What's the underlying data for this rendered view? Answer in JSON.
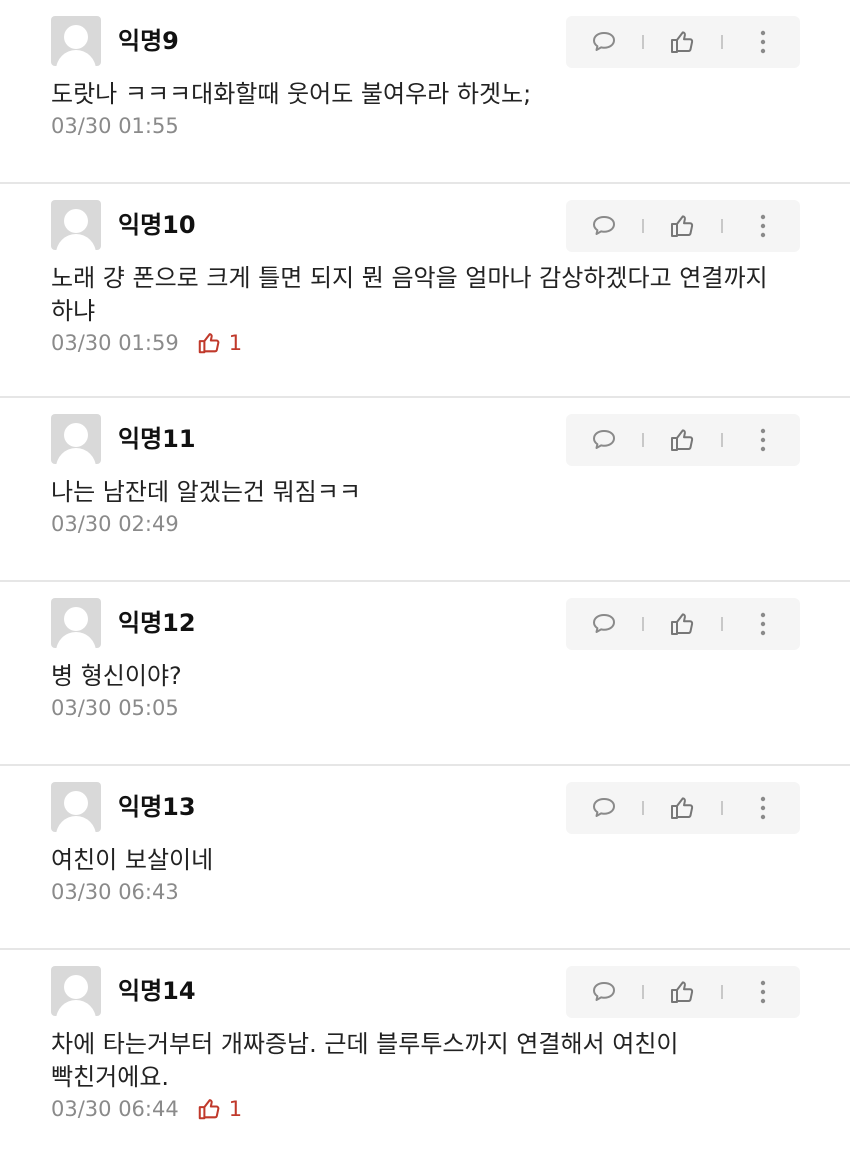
{
  "comments": [
    {
      "author": "익명9",
      "text": "도랏나 ㅋㅋㅋ대화할때 웃어도 불여우라 하겟노;",
      "time": "03/30 01:55",
      "likes": ""
    },
    {
      "author": "익명10",
      "text": "노래 걍 폰으로 크게 틀면 되지 뭔 음악을 얼마나 감상하겠다고 연결까지\n하냐",
      "time": "03/30 01:59",
      "likes": "1"
    },
    {
      "author": "익명11",
      "text": "나는 남잔데 알겠는건 뭐짐ㅋㅋ",
      "time": "03/30 02:49",
      "likes": ""
    },
    {
      "author": "익명12",
      "text": "병 형신이야?",
      "time": "03/30 05:05",
      "likes": ""
    },
    {
      "author": "익명13",
      "text": "여친이 보살이네",
      "time": "03/30 06:43",
      "likes": ""
    },
    {
      "author": "익명14",
      "text": "차에 타는거부터 개짜증남. 근데 블루투스까지 연결해서 여친이\n빡친거에요.",
      "time": "03/30 06:44",
      "likes": "1"
    }
  ],
  "icons": {
    "reply": "speech-bubble-icon",
    "like": "thumbs-up-icon",
    "more": "vertical-dots-icon"
  },
  "colors": {
    "like_active": "#c0392b",
    "meta_text": "#8a8a8a",
    "action_bg": "#f5f5f5",
    "divider": "#e6e6e6"
  }
}
